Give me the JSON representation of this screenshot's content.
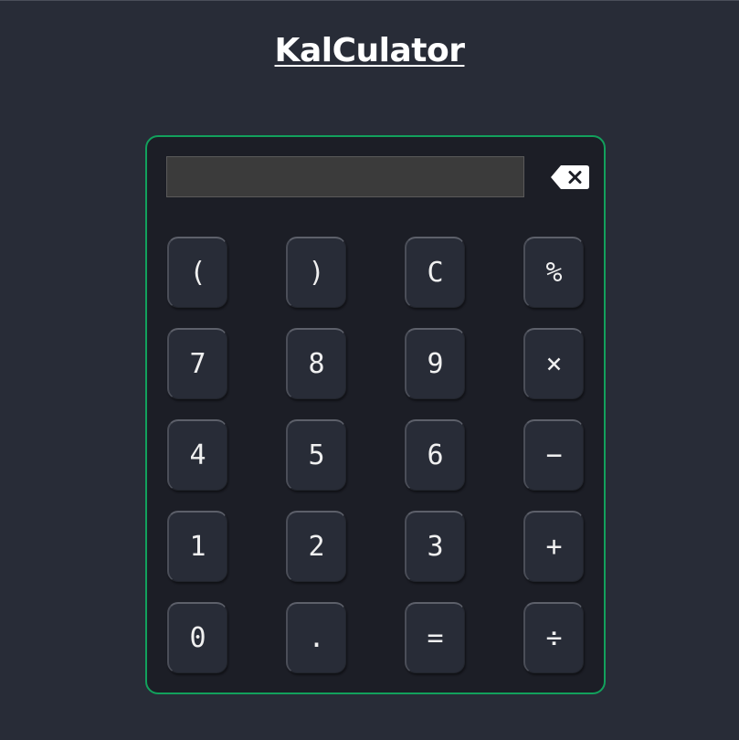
{
  "app": {
    "title": "KalCulator"
  },
  "display": {
    "value": ""
  },
  "colors": {
    "background": "#282c37",
    "panel": "#1c1e26",
    "panel_border": "#12a05c",
    "key": "#282c37",
    "display": "#3b3b3b"
  },
  "icons": {
    "backspace": "backspace-icon"
  },
  "keys": [
    [
      "(",
      ")",
      "C",
      "%"
    ],
    [
      "7",
      "8",
      "9",
      "×"
    ],
    [
      "4",
      "5",
      "6",
      "−"
    ],
    [
      "1",
      "2",
      "3",
      "+"
    ],
    [
      "0",
      ".",
      "=",
      "÷"
    ]
  ]
}
